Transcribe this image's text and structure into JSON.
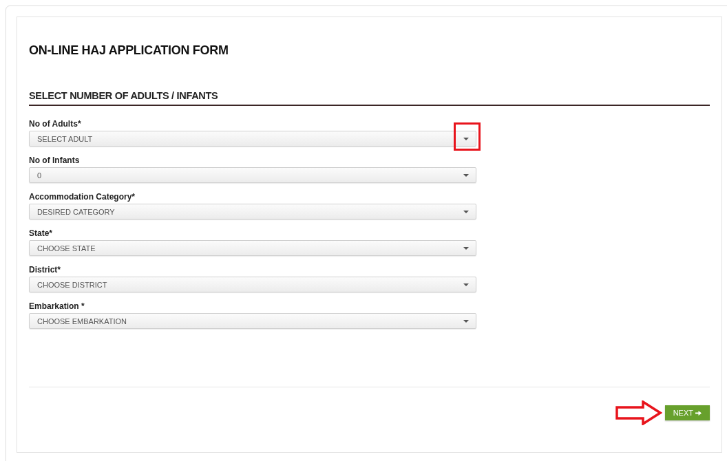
{
  "form": {
    "title": "ON-LINE HAJ APPLICATION FORM",
    "section_title": "SELECT NUMBER OF ADULTS / INFANTS",
    "fields": [
      {
        "label": "No of Adults*",
        "value": "SELECT ADULT"
      },
      {
        "label": "No of Infants",
        "value": "0"
      },
      {
        "label": "Accommodation Category*",
        "value": "DESIRED CATEGORY"
      },
      {
        "label": "State*",
        "value": "CHOOSE STATE"
      },
      {
        "label": "District*",
        "value": "CHOOSE DISTRICT"
      },
      {
        "label": "Embarkation *",
        "value": "CHOOSE EMBARKATION"
      }
    ],
    "next_button": "NEXT"
  }
}
